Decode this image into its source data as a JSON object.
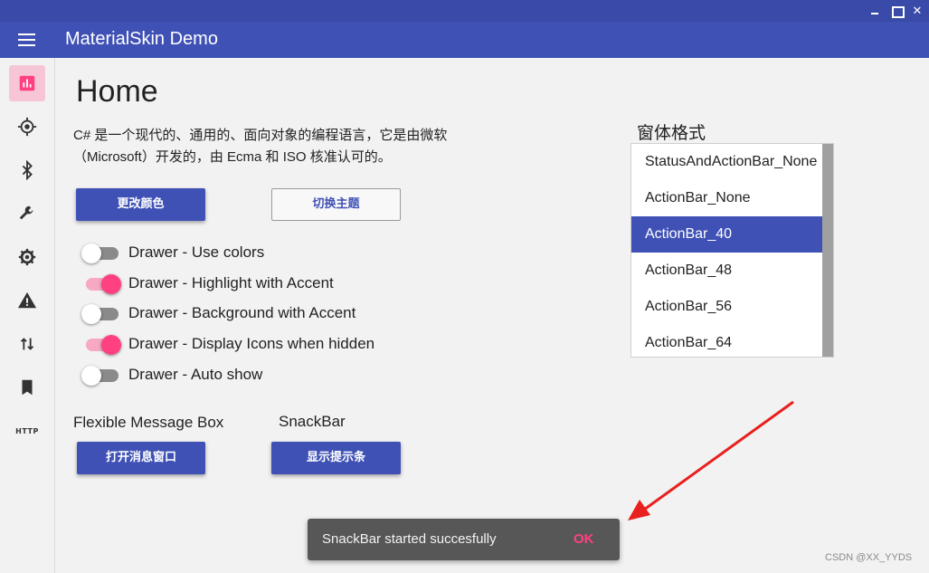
{
  "window": {
    "title": "MaterialSkin Demo",
    "controls": [
      "minimize-icon",
      "maximize-icon",
      "close-icon"
    ]
  },
  "sidebar": {
    "items": [
      {
        "icon": "chart-icon",
        "active": true
      },
      {
        "icon": "gps-icon",
        "active": false
      },
      {
        "icon": "bluetooth-icon",
        "active": false
      },
      {
        "icon": "wrench-icon",
        "active": false
      },
      {
        "icon": "gear-icon",
        "active": false
      },
      {
        "icon": "warning-icon",
        "active": false
      },
      {
        "icon": "swap-vertical-icon",
        "active": false
      },
      {
        "icon": "bookmark-icon",
        "active": false
      },
      {
        "icon": "http-icon",
        "label": "HTTP",
        "active": false
      }
    ]
  },
  "home": {
    "title": "Home",
    "description": "C# 是一个现代的、通用的、面向对象的编程语言，它是由微软（Microsoft）开发的，由 Ecma 和 ISO 核准认可的。",
    "change_color_button": "更改颜色",
    "switch_theme_button": "切换主题",
    "toggles": [
      {
        "label": "Drawer - Use colors",
        "on": false
      },
      {
        "label": "Drawer - Highlight with Accent",
        "on": true
      },
      {
        "label": "Drawer - Background with Accent",
        "on": false
      },
      {
        "label": "Drawer - Display Icons when hidden",
        "on": true
      },
      {
        "label": "Drawer - Auto show",
        "on": false
      }
    ],
    "flexible_message_box_label": "Flexible Message Box",
    "open_message_button": "打开消息窗口",
    "snackbar_label": "SnackBar",
    "show_snackbar_button": "显示提示条"
  },
  "form_style": {
    "title": "窗体格式",
    "options": [
      "StatusAndActionBar_None",
      "ActionBar_None",
      "ActionBar_40",
      "ActionBar_48",
      "ActionBar_56",
      "ActionBar_64"
    ],
    "selected": "ActionBar_40"
  },
  "snackbar": {
    "message": "SnackBar started succesfully",
    "action": "OK"
  },
  "watermark": "CSDN @XX_YYDS",
  "colors": {
    "primary": "#3f51b5",
    "accent": "#ff4081",
    "annotation_arrow": "#e8201e"
  }
}
